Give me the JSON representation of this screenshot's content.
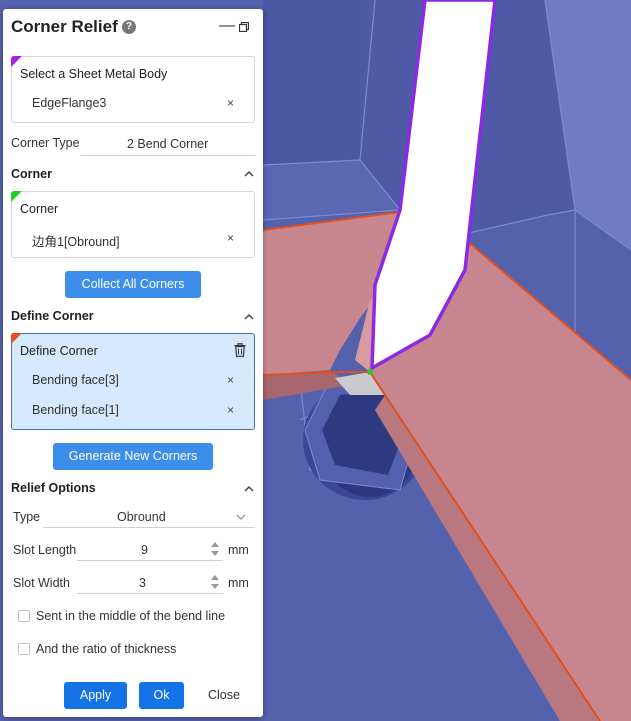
{
  "panel": {
    "title": "Corner Relief",
    "help_glyph": "?",
    "minimize_glyph": "—"
  },
  "body_select": {
    "label": "Select a Sheet Metal Body",
    "item": "EdgeFlange3"
  },
  "corner_type": {
    "label": "Corner Type",
    "value": "2 Bend Corner"
  },
  "corner_section": {
    "title": "Corner",
    "box_label": "Corner",
    "item": "边角1[Obround]",
    "collect_button": "Collect All Corners"
  },
  "define_section": {
    "title": "Define Corner",
    "box_label": "Define Corner",
    "items": [
      "Bending face[3]",
      "Bending face[1]"
    ],
    "generate_button": "Generate New Corners"
  },
  "relief_options": {
    "title": "Relief Options",
    "type_label": "Type",
    "type_value": "Obround",
    "slot_length_label": "Slot Length",
    "slot_length_value": "9",
    "slot_width_label": "Slot Width",
    "slot_width_value": "3",
    "unit": "mm",
    "check_middle": "Sent in the middle of the bend line",
    "check_ratio": "And the ratio of thickness"
  },
  "footer": {
    "apply": "Apply",
    "ok": "Ok",
    "close": "Close"
  },
  "glyphs": {
    "remove": "×"
  },
  "colors": {
    "accent": "#3c8eea",
    "ok": "#1473e6",
    "active_box": "#d6e8fb",
    "marker_purple": "#a321e0",
    "marker_green": "#22cc22",
    "marker_orange": "#e0501e",
    "viewport": "#5664b0",
    "flange": "#c9868e"
  }
}
